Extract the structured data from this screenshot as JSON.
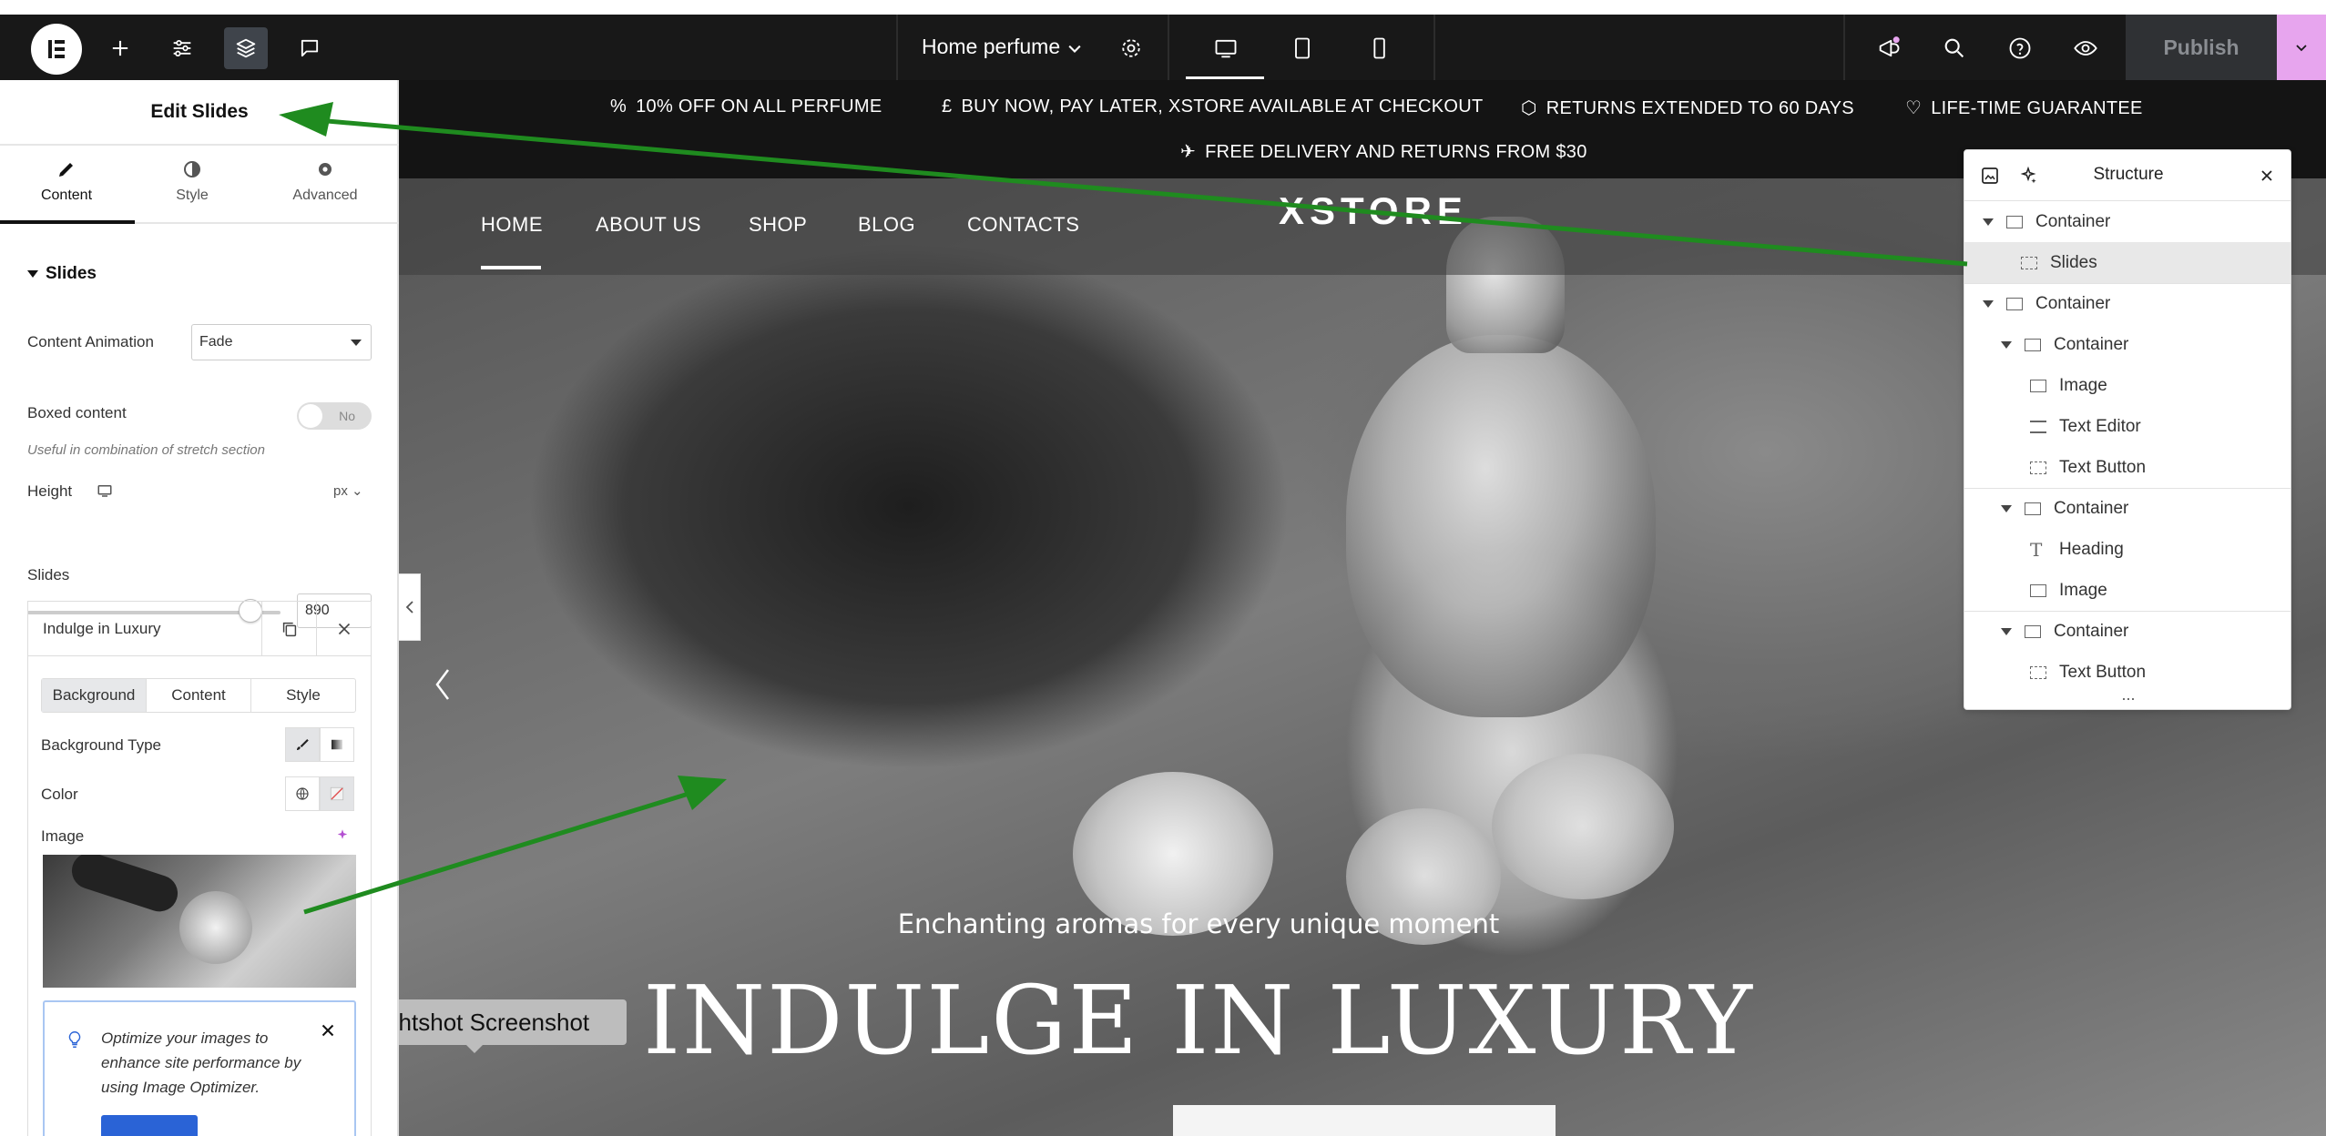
{
  "topbar": {
    "page_name": "Home perfume",
    "publish_label": "Publish",
    "accent": "#e7a5ee"
  },
  "panel": {
    "title": "Edit Slides",
    "tabs": [
      {
        "label": "Content",
        "icon": "pencil-icon"
      },
      {
        "label": "Style",
        "icon": "half-circle-icon"
      },
      {
        "label": "Advanced",
        "icon": "gear-icon"
      }
    ],
    "section": "Slides",
    "content_animation_label": "Content Animation",
    "content_animation_value": "Fade",
    "boxed_content_label": "Boxed content",
    "boxed_content_value": "No",
    "boxed_hint": "Useful in combination of stretch section",
    "height_label": "Height",
    "height_unit": "px",
    "height_value": "890",
    "slides_label": "Slides",
    "slide_item_title": "Indulge in Luxury",
    "inner_tabs": [
      "Background",
      "Content",
      "Style"
    ],
    "background_type_label": "Background Type",
    "color_label": "Color",
    "image_label": "Image",
    "notice_text": "Optimize your images to enhance site performance by using Image Optimizer."
  },
  "canvas": {
    "promos": [
      "10% OFF ON ALL PERFUME",
      "BUY NOW, PAY LATER, XSTORE AVAILABLE AT CHECKOUT",
      "RETURNS EXTENDED TO 60 DAYS",
      "LIFE-TIME GUARANTEE",
      "FREE DELIVERY AND RETURNS FROM $30"
    ],
    "nav": [
      "HOME",
      "ABOUT US",
      "SHOP",
      "BLOG",
      "CONTACTS"
    ],
    "brand": "XSTORE",
    "subtitle": "Enchanting aromas for every unique moment",
    "headline": "INDULGE IN LUXURY",
    "tooltip": "Lightshot Screenshot"
  },
  "structure": {
    "title": "Structure",
    "items": [
      {
        "label": "Container"
      },
      {
        "label": "Slides"
      },
      {
        "label": "Container"
      },
      {
        "label": "Container"
      },
      {
        "label": "Image"
      },
      {
        "label": "Text Editor"
      },
      {
        "label": "Text Button"
      },
      {
        "label": "Container"
      },
      {
        "label": "Heading"
      },
      {
        "label": "Image"
      },
      {
        "label": "Container"
      },
      {
        "label": "Text Button"
      }
    ],
    "more": "..."
  },
  "colors": {
    "annotation_arrow": "#1f8b1f",
    "topbar_bg": "#181818"
  }
}
